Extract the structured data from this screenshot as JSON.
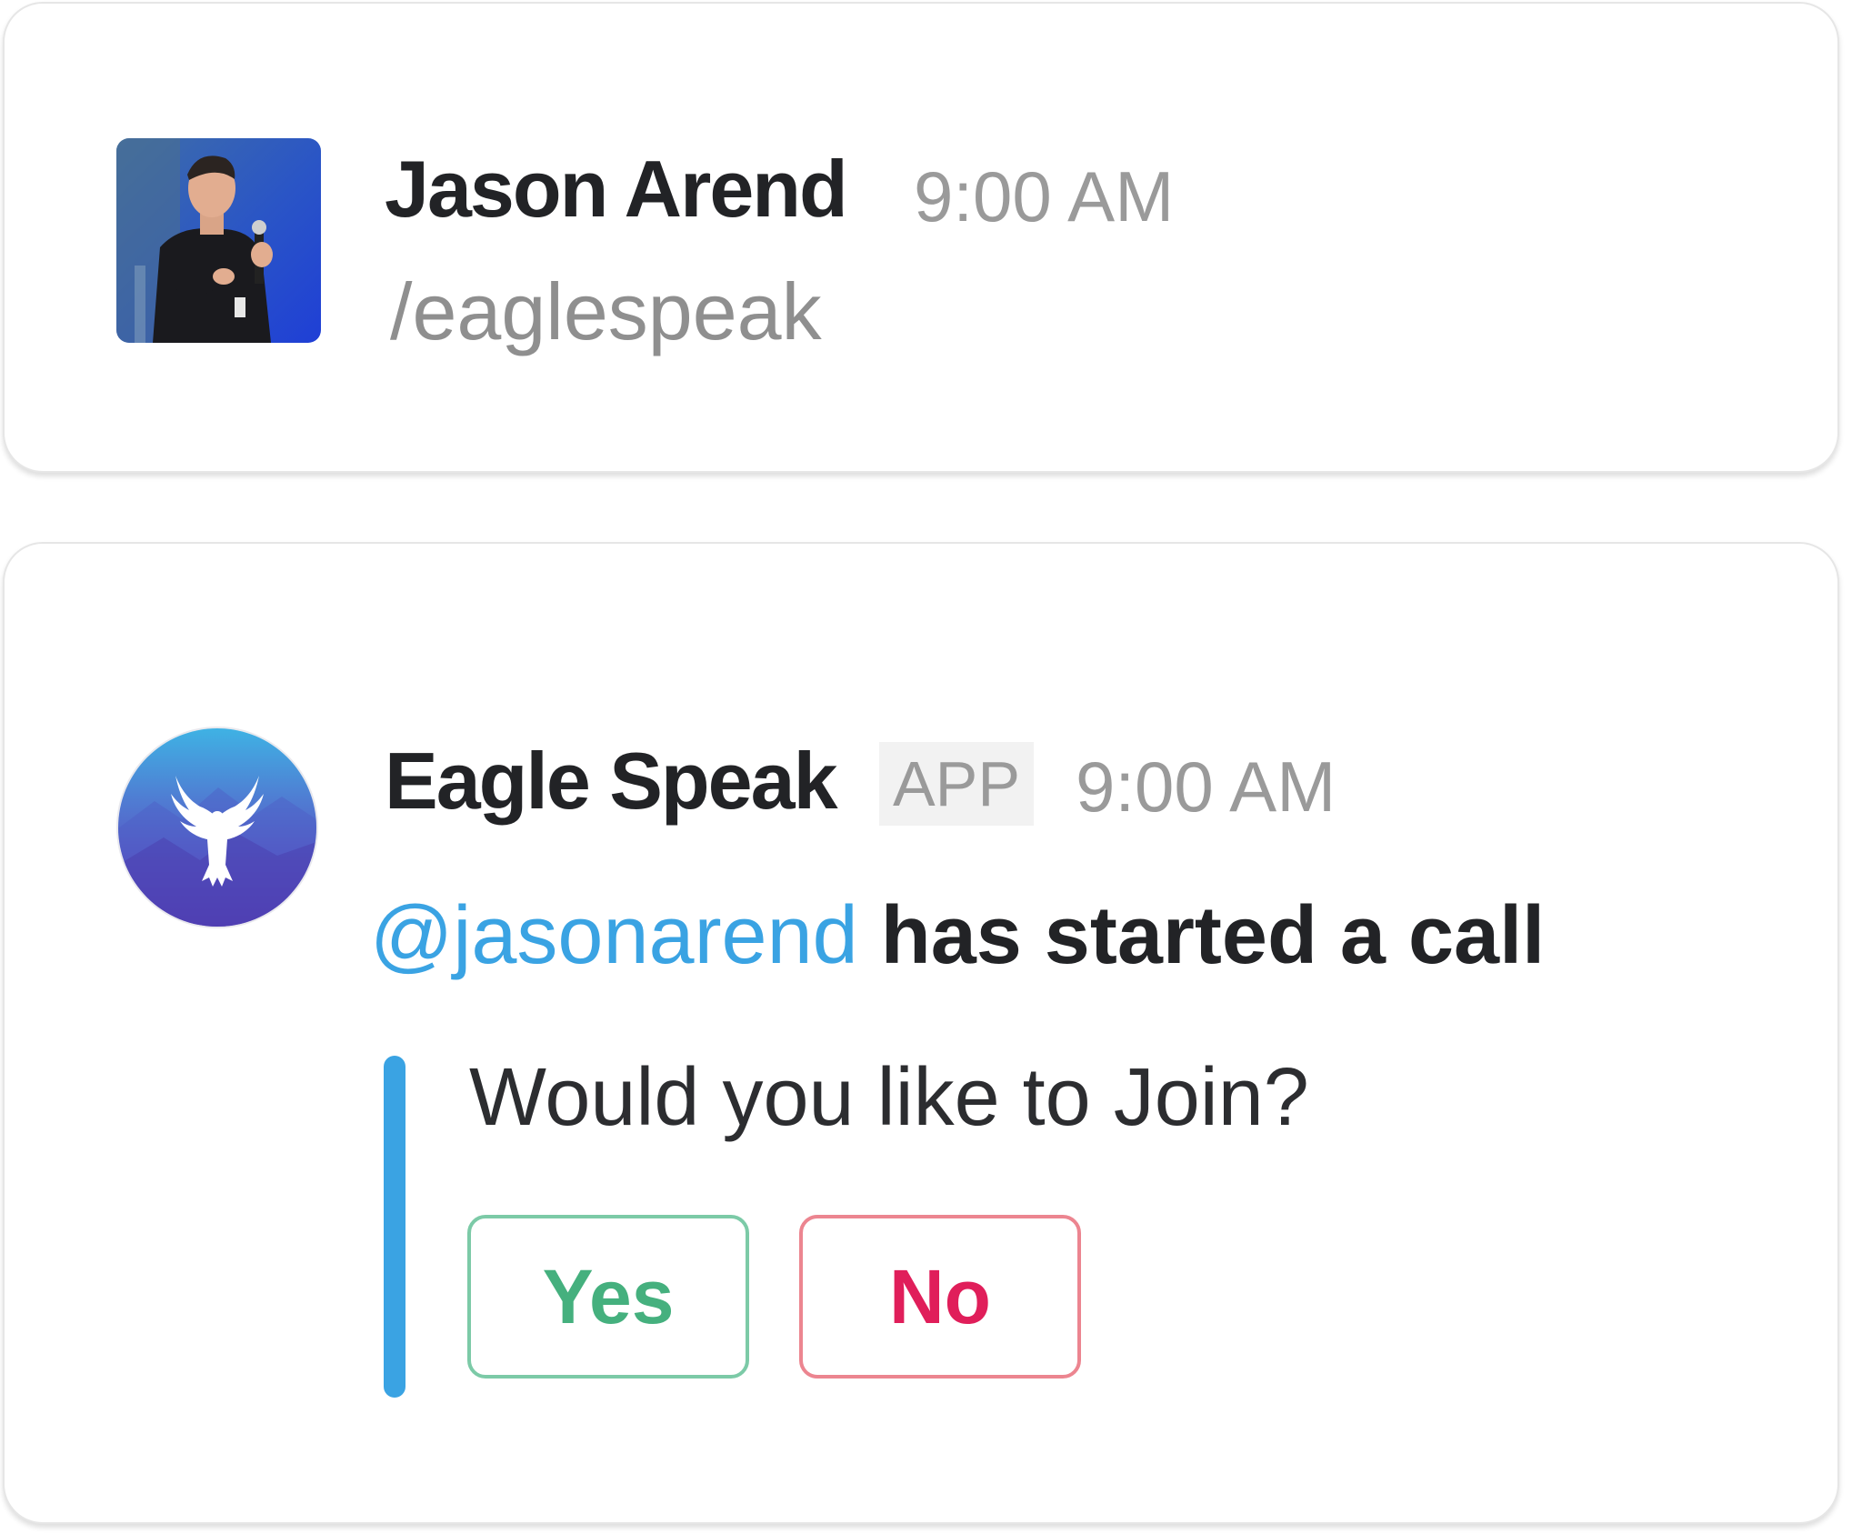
{
  "message_1": {
    "author": "Jason Arend",
    "timestamp": "9:00 AM",
    "text": "/eaglespeak",
    "avatar": "user-photo"
  },
  "message_2": {
    "author": "Eagle Speak",
    "badge": "APP",
    "timestamp": "9:00 AM",
    "avatar": "eagle-logo",
    "mention": "@jasonarend",
    "text": " has started a call",
    "attachment": {
      "question": "Would you like to Join?",
      "accent_color": "#3aa3e3",
      "yes_label": "Yes",
      "no_label": "No"
    }
  },
  "colors": {
    "mention": "#3aa3e3",
    "yes": "#45b07e",
    "no": "#e01e5a"
  }
}
